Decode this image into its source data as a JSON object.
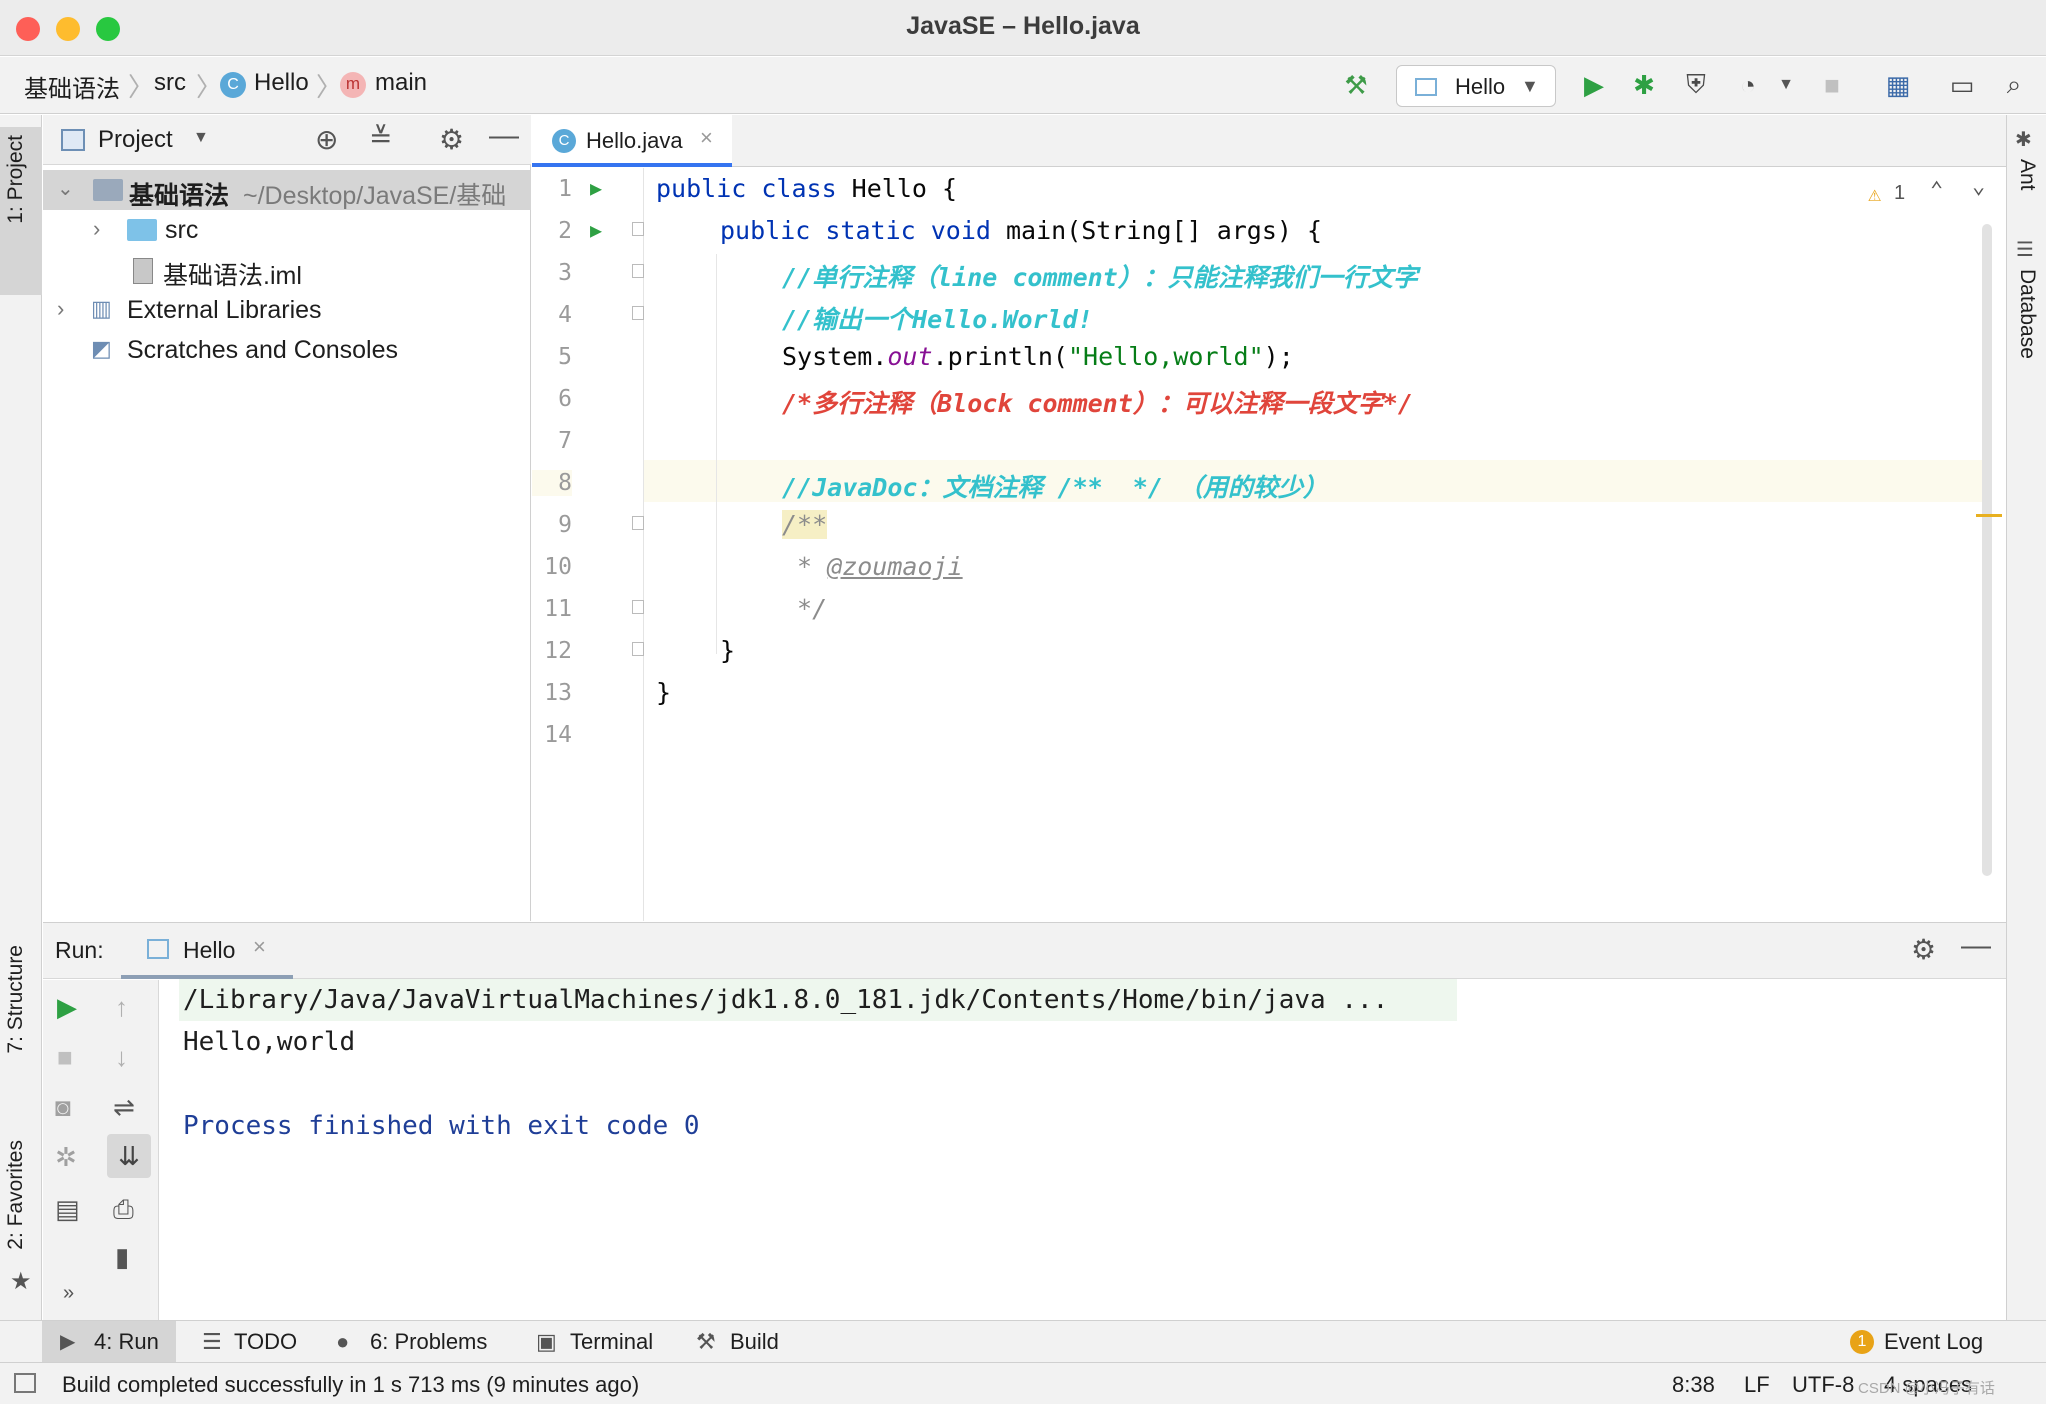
{
  "window": {
    "title": "JavaSE – Hello.java"
  },
  "breadcrumb": {
    "project": "基础语法",
    "folder": "src",
    "class": "Hello",
    "method": "main"
  },
  "run_config": {
    "selected": "Hello"
  },
  "project_panel": {
    "title": "Project",
    "tree": [
      {
        "name": "基础语法",
        "path": "~/Desktop/JavaSE/基础"
      },
      {
        "name": "src"
      },
      {
        "name": "基础语法.iml"
      },
      {
        "name": "External Libraries"
      },
      {
        "name": "Scratches and Consoles"
      }
    ]
  },
  "left_strip": {
    "project": "1: Project",
    "structure": "7: Structure",
    "favorites": "2: Favorites"
  },
  "right_strip": {
    "ant": "Ant",
    "database": "Database"
  },
  "editor": {
    "tab": "Hello.java",
    "warnings": "1",
    "lines": [
      "1",
      "2",
      "3",
      "4",
      "5",
      "6",
      "7",
      "8",
      "9",
      "10",
      "11",
      "12",
      "13",
      "14"
    ],
    "code": {
      "l1_kw": "public class ",
      "l1_rest": "Hello {",
      "l2_kw": "public static void ",
      "l2_rest": "main(String[] args) {",
      "l3": "//单行注释（line comment）：只能注释我们一行文字",
      "l4": "//输出一个Hello.World!",
      "l5_a": "System.",
      "l5_b": "out",
      "l5_c": ".println(",
      "l5_d": "\"Hello,world\"",
      "l5_e": ");",
      "l6": "/*多行注释（Block comment）：可以注释一段文字*/",
      "l8": "//JavaDoc：文档注释 /**  */ （用的较少）",
      "l9": "/**",
      "l10_a": " * ",
      "l10_b": "@zoumaoji",
      "l11": " */",
      "l12": "}",
      "l13": "}"
    }
  },
  "run_panel": {
    "label": "Run:",
    "tab": "Hello",
    "output": [
      "/Library/Java/JavaVirtualMachines/jdk1.8.0_181.jdk/Contents/Home/bin/java ...",
      "Hello,world",
      "",
      "Process finished with exit code 0"
    ]
  },
  "bottom_tabs": {
    "run": "4: Run",
    "todo": "TODO",
    "problems": "6: Problems",
    "terminal": "Terminal",
    "build": "Build",
    "event_log": "Event Log",
    "event_count": "1"
  },
  "status": {
    "message": "Build completed successfully in 1 s 713 ms (9 minutes ago)",
    "position": "8:38",
    "line_sep": "LF",
    "encoding": "UTF-8",
    "indent": "4 spaces",
    "watermark": "CSDN @小冯子有话"
  },
  "colors": {
    "accent": "#3574f0",
    "run_green": "#2ea043",
    "keyword": "#0033b3",
    "comment_cyan": "#34c1cc",
    "comment_red": "#e0453b"
  }
}
